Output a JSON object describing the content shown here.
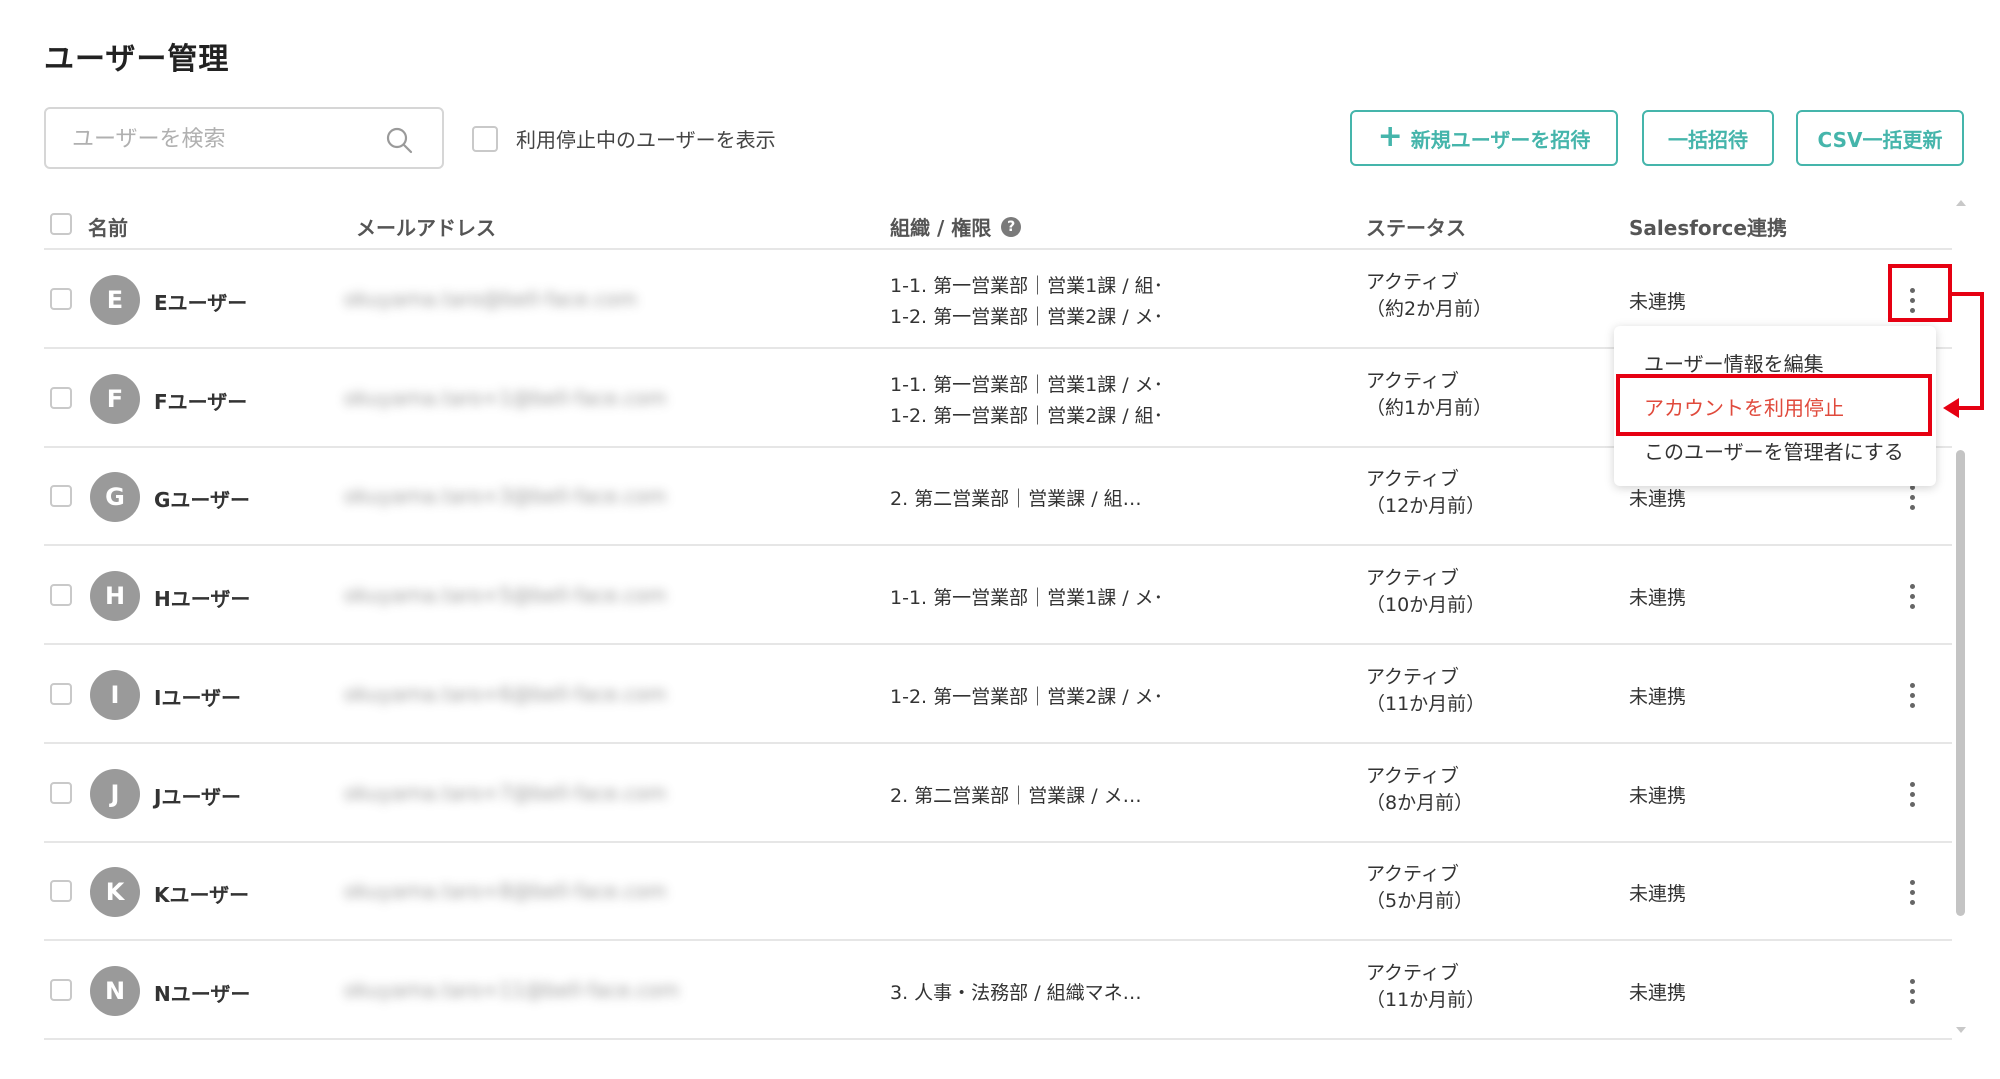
{
  "page": {
    "title": "ユーザー管理"
  },
  "search": {
    "placeholder": "ユーザーを検索",
    "value": ""
  },
  "filters": {
    "show_suspended_label": "利用停止中のユーザーを表示"
  },
  "actions": {
    "invite_label": "新規ユーザーを招待",
    "bulk_invite_label": "一括招待",
    "csv_update_label": "CSV一括更新"
  },
  "table": {
    "headers": {
      "name": "名前",
      "email": "メールアドレス",
      "org": "組織 / 権限",
      "status": "ステータス",
      "salesforce": "Salesforce連携"
    },
    "rows": [
      {
        "initial": "E",
        "name": "Eユーザー",
        "email": "okuyama.taro@bell-face.com",
        "org": [
          "1-1. 第一営業部｜営業1課 / 組･",
          "1-2. 第一営業部｜営業2課 / メ･"
        ],
        "status": [
          "アクティブ",
          "（約2か月前）"
        ],
        "sf": "未連携"
      },
      {
        "initial": "F",
        "name": "Fユーザー",
        "email": "okuyama.taro+1@bell-face.com",
        "org": [
          "1-1. 第一営業部｜営業1課 / メ･",
          "1-2. 第一営業部｜営業2課 / 組･"
        ],
        "status": [
          "アクティブ",
          "（約1か月前）"
        ],
        "sf": ""
      },
      {
        "initial": "G",
        "name": "Gユーザー",
        "email": "okuyama.taro+3@bell-face.com",
        "org": [
          "2. 第二営業部｜営業課 / 組…"
        ],
        "status": [
          "アクティブ",
          "（12か月前）"
        ],
        "sf": "未連携"
      },
      {
        "initial": "H",
        "name": "Hユーザー",
        "email": "okuyama.taro+5@bell-face.com",
        "org": [
          "1-1. 第一営業部｜営業1課 / メ･"
        ],
        "status": [
          "アクティブ",
          "（10か月前）"
        ],
        "sf": "未連携"
      },
      {
        "initial": "I",
        "name": "Iユーザー",
        "email": "okuyama.taro+6@bell-face.com",
        "org": [
          "1-2. 第一営業部｜営業2課 / メ･"
        ],
        "status": [
          "アクティブ",
          "（11か月前）"
        ],
        "sf": "未連携"
      },
      {
        "initial": "J",
        "name": "Jユーザー",
        "email": "okuyama.taro+7@bell-face.com",
        "org": [
          "2. 第二営業部｜営業課 / メ…"
        ],
        "status": [
          "アクティブ",
          "（8か月前）"
        ],
        "sf": "未連携"
      },
      {
        "initial": "K",
        "name": "Kユーザー",
        "email": "okuyama.taro+8@bell-face.com",
        "org": [],
        "status": [
          "アクティブ",
          "（5か月前）"
        ],
        "sf": "未連携"
      },
      {
        "initial": "N",
        "name": "Nユーザー",
        "email": "okuyama.taro+11@bell-face.com",
        "org": [
          "3. 人事・法務部 / 組織マネ…"
        ],
        "status": [
          "アクティブ",
          "（11か月前）"
        ],
        "sf": "未連携"
      }
    ]
  },
  "menu": {
    "edit_label": "ユーザー情報を編集",
    "suspend_label": "アカウントを利用停止",
    "make_admin_label": "このユーザーを管理者にする"
  },
  "icons": {
    "search": "search-icon",
    "plus": "plus-icon",
    "help": "help-icon",
    "kebab": "kebab-menu-icon"
  },
  "colors": {
    "accent": "#45b5ab",
    "danger_text": "#e04a3c",
    "highlight": "#e60012",
    "avatar": "#9a9a9a"
  }
}
